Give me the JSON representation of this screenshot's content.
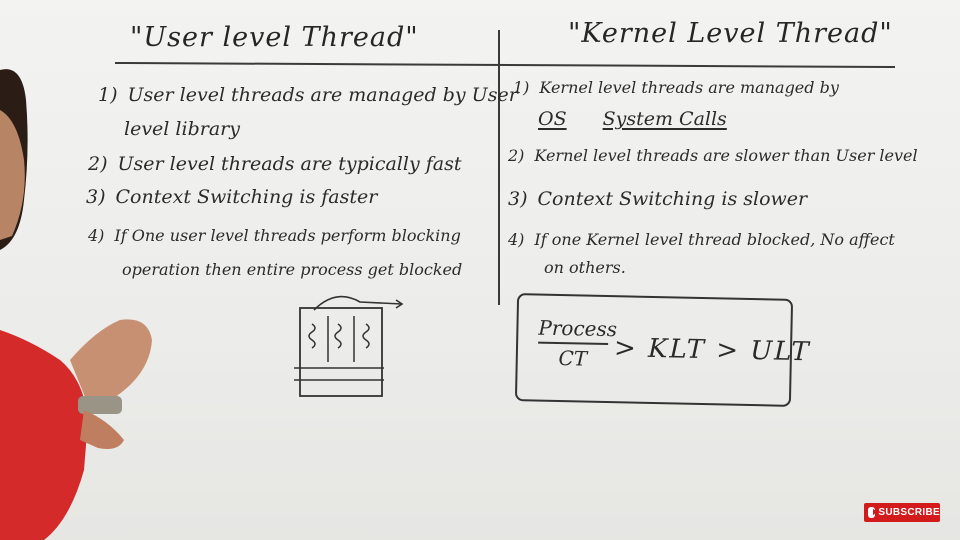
{
  "left_column": {
    "title": "\"User level Thread\"",
    "items": [
      {
        "num": "1)",
        "line1": "User level threads are managed by User",
        "line2": "level library"
      },
      {
        "num": "2)",
        "line1": "User level threads are typically fast"
      },
      {
        "num": "3)",
        "line1": "Context Switching is faster"
      },
      {
        "num": "4)",
        "line1": "If One user level threads perform blocking",
        "line2": "operation then entire process get blocked"
      }
    ]
  },
  "right_column": {
    "title": "\"Kernel Level Thread\"",
    "items": [
      {
        "num": "1)",
        "line1": "Kernel level threads are managed by",
        "line2_a": "OS",
        "line2_b": "System Calls"
      },
      {
        "num": "2)",
        "line1": "Kernel level threads are slower than User level"
      },
      {
        "num": "3)",
        "line1": "Context Switching is slower"
      },
      {
        "num": "4)",
        "line1": "If one Kernel level thread blocked, No affect",
        "line2": "on others."
      }
    ]
  },
  "formula": {
    "numerator": "Process",
    "denominator": "CT",
    "rest": "> KLT > ULT"
  },
  "subscribe": {
    "label": "SUBSCRIBE"
  },
  "colors": {
    "ink": "#2a2a2a",
    "board": "#efefed",
    "subscribe": "#d41b1b",
    "shirt": "#d42a2a"
  }
}
